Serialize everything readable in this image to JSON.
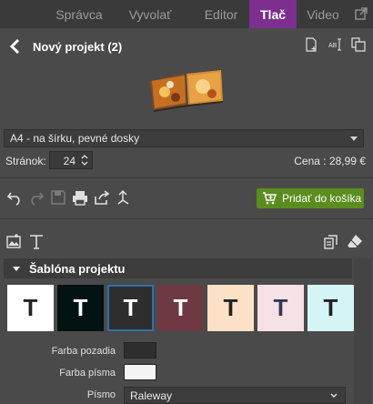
{
  "tabs": [
    {
      "label": "Správca"
    },
    {
      "label": "Vyvolať"
    },
    {
      "label": "Editor"
    },
    {
      "label": "Tlač"
    },
    {
      "label": "Video"
    }
  ],
  "project": {
    "title": "Nový projekt (2)",
    "format": "A4 - na šírku, pevné dosky",
    "pages_label": "Stránok:",
    "pages_value": "24",
    "price": "Cena : 28,99 €"
  },
  "toolbar": {
    "icons": [
      "undo-icon",
      "redo-icon",
      "save-icon",
      "print-icon",
      "share-icon",
      "arrange-icon"
    ],
    "cart_label": "Pridať do košíka"
  },
  "section": {
    "title": "Šablóna projektu"
  },
  "templates": [
    {
      "letter": "T",
      "bg": "#ffffff",
      "fg": "#222222"
    },
    {
      "letter": "T",
      "bg": "#031313",
      "fg": "#ffffff"
    },
    {
      "letter": "T",
      "bg": "#2e2e2e",
      "fg": "#ffffff"
    },
    {
      "letter": "T",
      "bg": "#6e3942",
      "fg": "#ffffff"
    },
    {
      "letter": "T",
      "bg": "#fde1c6",
      "fg": "#222222"
    },
    {
      "letter": "T",
      "bg": "#f6e1e6",
      "fg": "#333a55"
    },
    {
      "letter": "T",
      "bg": "#d6f5f6",
      "fg": "#222222"
    }
  ],
  "properties": {
    "bg_color_label": "Farba pozadia",
    "bg_color": "#2e2e2e",
    "font_color_label": "Farba písma",
    "font_color": "#f4f4f4",
    "font_label": "Písmo",
    "font_value": "Raleway"
  },
  "colors": {
    "accent": "#7c2f8f",
    "cart_green": "#5a8d1e",
    "selection_blue": "#2f6fae"
  }
}
